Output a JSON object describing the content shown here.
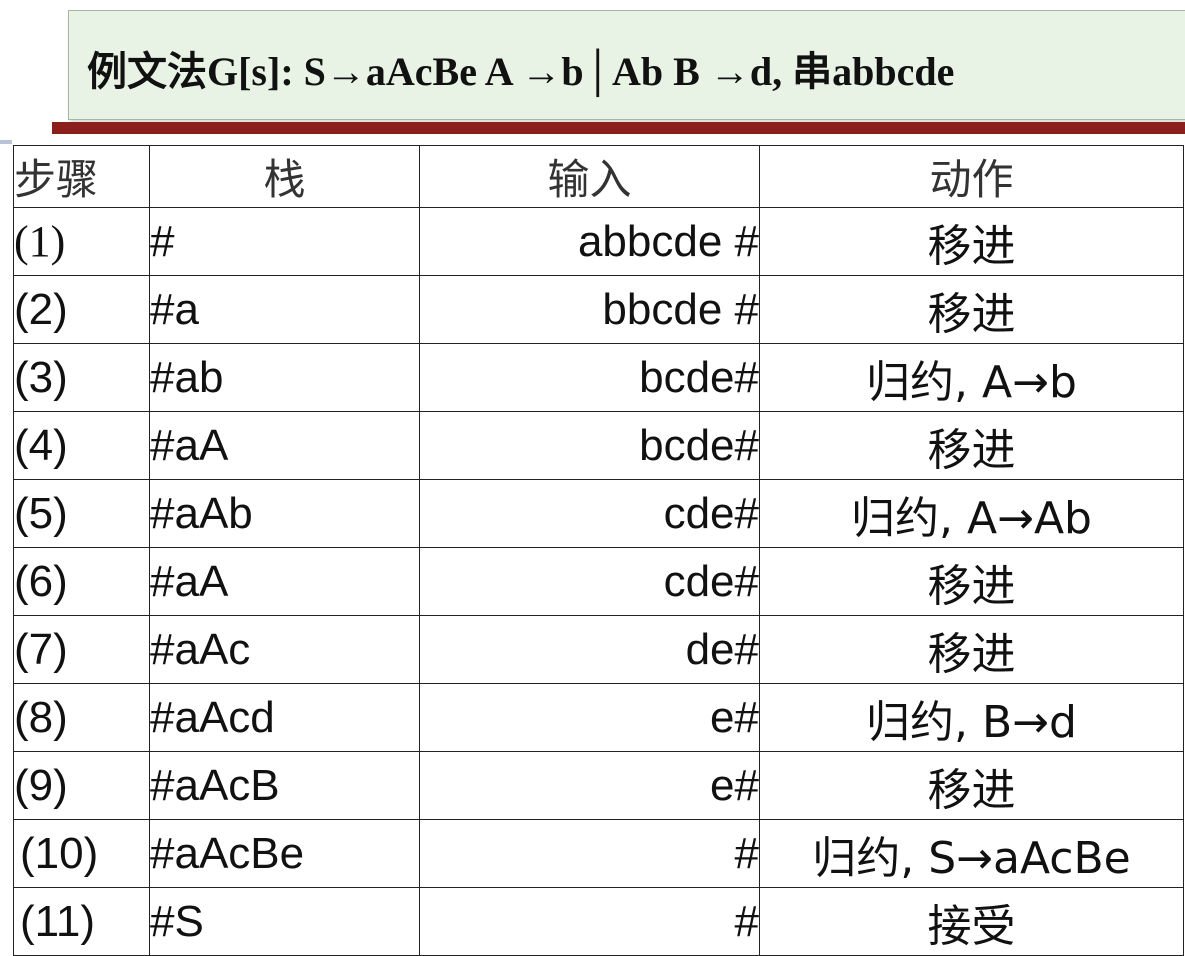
{
  "header": {
    "title_text": "例文法G[s]:  S→aAcBe   A →b│Ab  B →d, 串abbcde"
  },
  "table": {
    "columns": [
      "步骤",
      "栈",
      "输入",
      "动作"
    ],
    "rows": [
      {
        "step": "(1)",
        "stack": "#",
        "input": "abbcde #",
        "action": "移进"
      },
      {
        "step": "(2)",
        "stack": "#a",
        "input": "bbcde #",
        "action": "移进"
      },
      {
        "step": "(3)",
        "stack": "#ab",
        "input": "bcde#",
        "action": "归约, A→b"
      },
      {
        "step": "(4)",
        "stack": "#aA",
        "input": "bcde#",
        "action": "移进"
      },
      {
        "step": "(5)",
        "stack": "#aAb",
        "input": "cde#",
        "action": "归约,  A→Ab"
      },
      {
        "step": "(6)",
        "stack": "#aA",
        "input": "cde#",
        "action": "移进"
      },
      {
        "step": "(7)",
        "stack": "#aAc",
        "input": "de#",
        "action": "移进"
      },
      {
        "step": "(8)",
        "stack": "#aAcd",
        "input": "e#",
        "action": "归约, B→d"
      },
      {
        "step": "(9)",
        "stack": "#aAcB",
        "input": "e#",
        "action": "移进"
      },
      {
        "step": "(10)",
        "stack": "#aAcBe",
        "input": "#",
        "action": "归约, S→aAcBe"
      },
      {
        "step": "(11)",
        "stack": "#S",
        "input": "#",
        "action": "接受"
      }
    ]
  },
  "colors": {
    "header_bg": "#e8f3e6",
    "accent_bar": "#8b1f1c"
  }
}
